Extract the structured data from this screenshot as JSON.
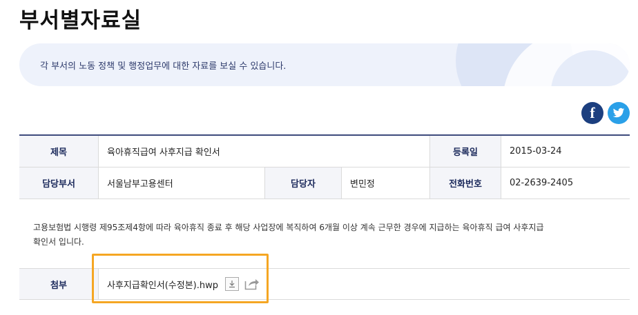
{
  "page": {
    "title": "부서별자료실",
    "banner_text": "각 부서의 노동 정책 및 행정업무에 대한 자료를 보실 수 있습니다."
  },
  "social": {
    "facebook_icon": "facebook-icon",
    "twitter_icon": "twitter-icon",
    "facebook_color": "#1c3f7f",
    "twitter_color": "#2aa0e8"
  },
  "table": {
    "title_label": "제목",
    "title_value": "육아휴직급여 사후지급 확인서",
    "date_label": "등록일",
    "date_value": "2015-03-24",
    "dept_label": "담당부서",
    "dept_value": "서울남부고용센터",
    "person_label": "담당자",
    "person_value": "변민정",
    "phone_label": "전화번호",
    "phone_value": "02-2639-2405",
    "description_line1": "고용보험법 시행령 제95조제4항에 따라 육아휴직 종료 후 해당 사업장에 복직하여 6개월 이상 계속 근무한 경우에 지급하는 육아휴직 급여 사후지급",
    "description_line2": "확인서 입니다.",
    "attach_label": "첨부",
    "attach_file": "사후지급확인서(수정본).hwp"
  },
  "colors": {
    "accent": "#3d4a7c",
    "highlight": "#f5a623"
  }
}
